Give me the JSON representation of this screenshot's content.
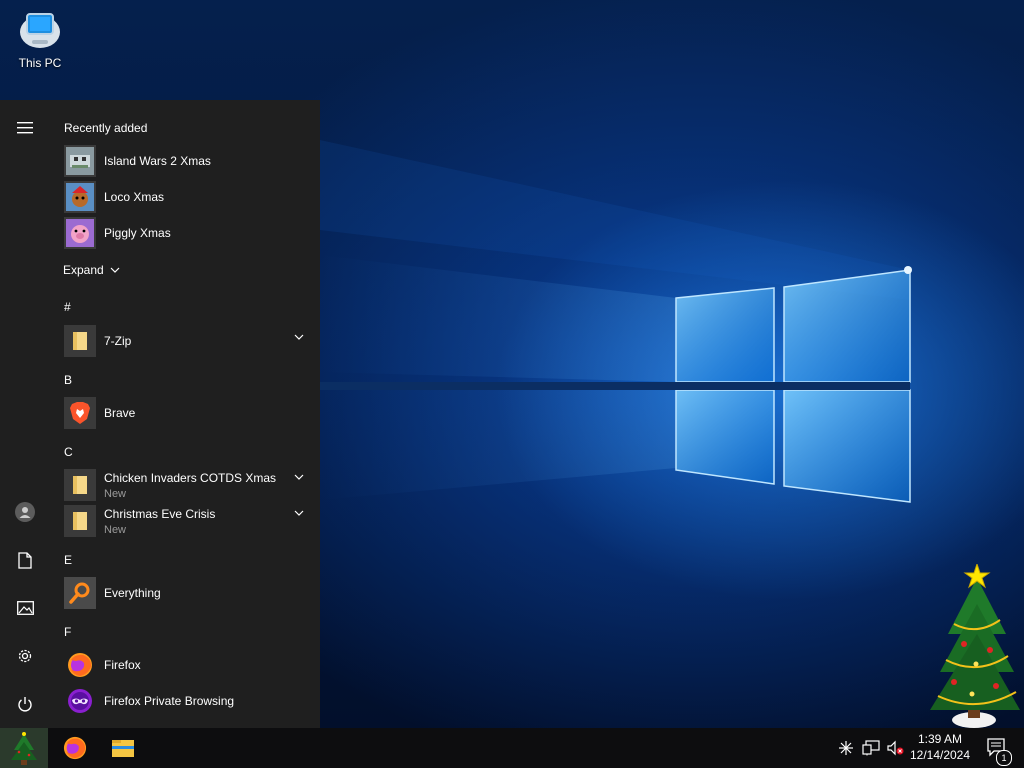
{
  "desktop": {
    "icons": [
      {
        "label": "This PC",
        "icon": "this-pc-icon"
      }
    ]
  },
  "start_menu": {
    "recently_added": {
      "header": "Recently added",
      "items": [
        {
          "name": "Island Wars 2 Xmas",
          "icon": "island-wars-icon"
        },
        {
          "name": "Loco Xmas",
          "icon": "loco-xmas-icon"
        },
        {
          "name": "Piggly Xmas",
          "icon": "piggly-xmas-icon"
        }
      ],
      "expand_label": "Expand"
    },
    "sections": [
      {
        "letter": "#",
        "apps": [
          {
            "name": "7-Zip",
            "icon": "folder-icon",
            "sub": ""
          }
        ]
      },
      {
        "letter": "B",
        "apps": [
          {
            "name": "Brave",
            "icon": "brave-icon",
            "sub": ""
          }
        ]
      },
      {
        "letter": "C",
        "apps": [
          {
            "name": "Chicken Invaders COTDS Xmas",
            "icon": "folder-icon",
            "sub": "New"
          },
          {
            "name": "Christmas Eve Crisis",
            "icon": "folder-icon",
            "sub": "New"
          }
        ]
      },
      {
        "letter": "E",
        "apps": [
          {
            "name": "Everything",
            "icon": "everything-icon",
            "sub": ""
          }
        ]
      },
      {
        "letter": "F",
        "apps": [
          {
            "name": "Firefox",
            "icon": "firefox-icon",
            "sub": ""
          },
          {
            "name": "Firefox Private Browsing",
            "icon": "firefox-private-icon",
            "sub": ""
          }
        ]
      }
    ],
    "rail": [
      "hamburger-menu-icon",
      "user-avatar-icon",
      "documents-icon",
      "pictures-icon",
      "settings-gear-icon",
      "power-icon"
    ]
  },
  "taskbar": {
    "pinned": [
      "start-button-icon",
      "firefox-icon",
      "file-explorer-icon"
    ],
    "tray": [
      "network-asterisk-icon",
      "network-monitor-icon",
      "volume-muted-icon"
    ],
    "clock": {
      "time": "1:39 AM",
      "date": "12/14/2024"
    },
    "notifications": {
      "count": "1"
    }
  },
  "colors": {
    "accent": "#0078d7",
    "menu_bg": "#1f1f1f",
    "taskbar_bg": "#0d0d0f"
  }
}
